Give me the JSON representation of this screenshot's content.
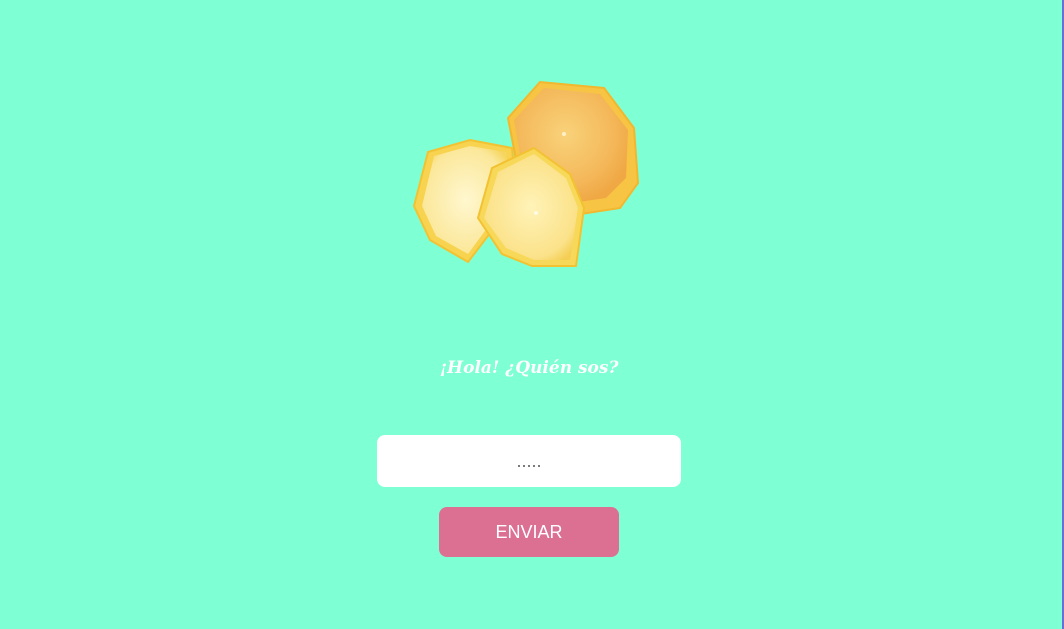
{
  "colors": {
    "background": "#7fffd4",
    "button": "#db7093",
    "text": "#ffffff"
  },
  "hero": {
    "image": "lemon-slices-image"
  },
  "greeting": {
    "text": "¡Hola! ¿Quién sos?"
  },
  "form": {
    "name_placeholder": ".....",
    "name_value": "",
    "submit_label": "ENVIAR"
  }
}
